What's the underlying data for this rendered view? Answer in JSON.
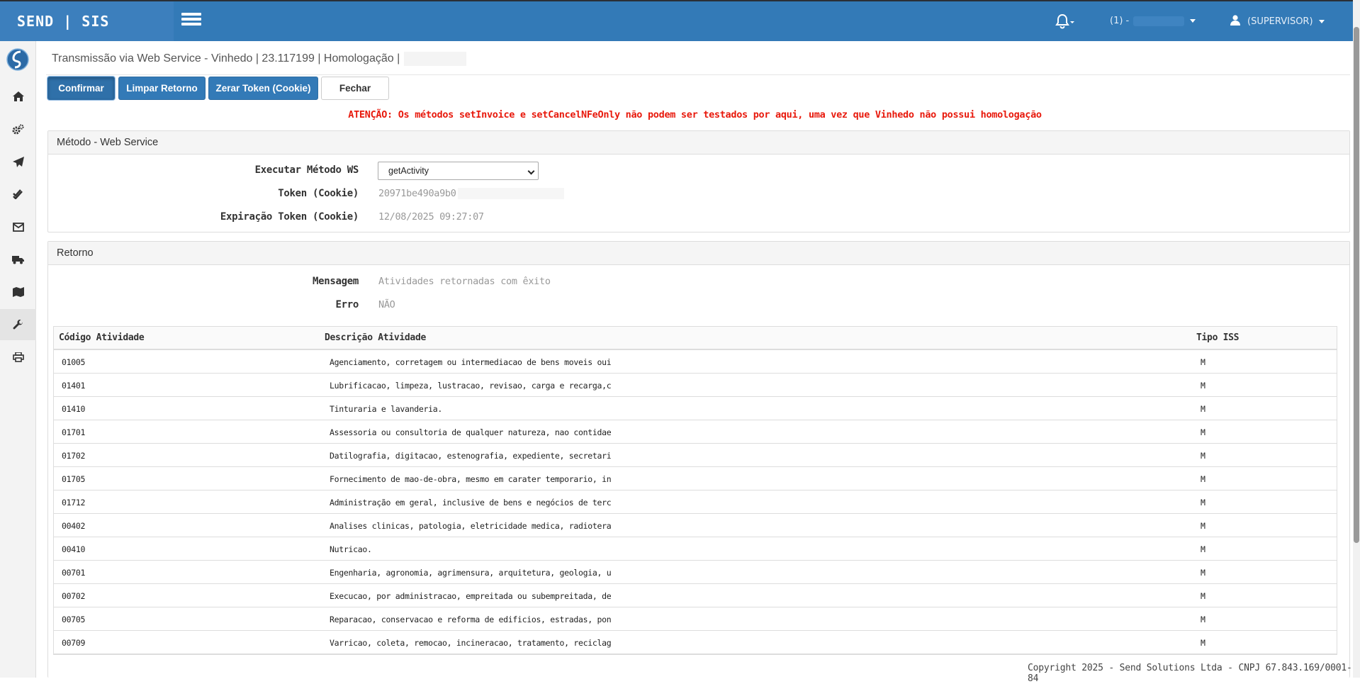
{
  "header": {
    "brand": "SEND | SIS",
    "company_label": "(1) -",
    "user_label": "(SUPERVISOR)"
  },
  "page": {
    "title": "Transmissão via Web Service - Vinhedo | 23.117199 | Homologação |"
  },
  "toolbar": {
    "confirm_label": "Confirmar",
    "clear_label": "Limpar Retorno",
    "reset_token_label": "Zerar Token (Cookie)",
    "close_label": "Fechar"
  },
  "warning": "ATENÇÃO: Os métodos setInvoice e setCancelNFeOnly não podem ser testados por aqui, uma vez que Vinhedo não possui homologação",
  "method_panel": {
    "title": "Método - Web Service",
    "method_label": "Executar Método WS",
    "method_value": "getActivity",
    "token_label": "Token (Cookie)",
    "token_value": "20971be490a9b0",
    "expiry_label": "Expiração Token (Cookie)",
    "expiry_value": "12/08/2025 09:27:07"
  },
  "return_panel": {
    "title": "Retorno",
    "message_label": "Mensagem",
    "message_value": "Atividades retornadas com êxito",
    "error_label": "Erro",
    "error_value": "NÃO"
  },
  "table": {
    "columns": [
      "Código Atividade",
      "Descrição Atividade",
      "Tipo ISS"
    ],
    "rows": [
      [
        "01005",
        "Agenciamento, corretagem ou intermediacao de bens moveis oui",
        "M"
      ],
      [
        "01401",
        "Lubrificacao, limpeza, lustracao, revisao, carga e recarga,c",
        "M"
      ],
      [
        "01410",
        "Tinturaria e lavanderia.",
        "M"
      ],
      [
        "01701",
        "Assessoria ou consultoria de qualquer natureza, nao contidae",
        "M"
      ],
      [
        "01702",
        "Datilografia, digitacao, estenografia, expediente, secretari",
        "M"
      ],
      [
        "01705",
        "Fornecimento de mao-de-obra, mesmo em carater temporario, in",
        "M"
      ],
      [
        "01712",
        "Administração em geral, inclusive de bens e negócios de terc",
        "M"
      ],
      [
        "00402",
        "Analises clinicas, patologia, eletricidade medica, radiotera",
        "M"
      ],
      [
        "00410",
        "Nutricao.",
        "M"
      ],
      [
        "00701",
        "Engenharia, agronomia, agrimensura, arquitetura, geologia, u",
        "M"
      ],
      [
        "00702",
        "Execucao, por administracao, empreitada ou subempreitada, de",
        "M"
      ],
      [
        "00705",
        "Reparacao, conservacao e reforma de edificios, estradas, pon",
        "M"
      ],
      [
        "00709",
        "Varricao, coleta, remocao, incineracao, tratamento, reciclag",
        "M"
      ]
    ]
  },
  "footer": "Copyright 2025 - Send Solutions Ltda - CNPJ 67.843.169/0001-84"
}
